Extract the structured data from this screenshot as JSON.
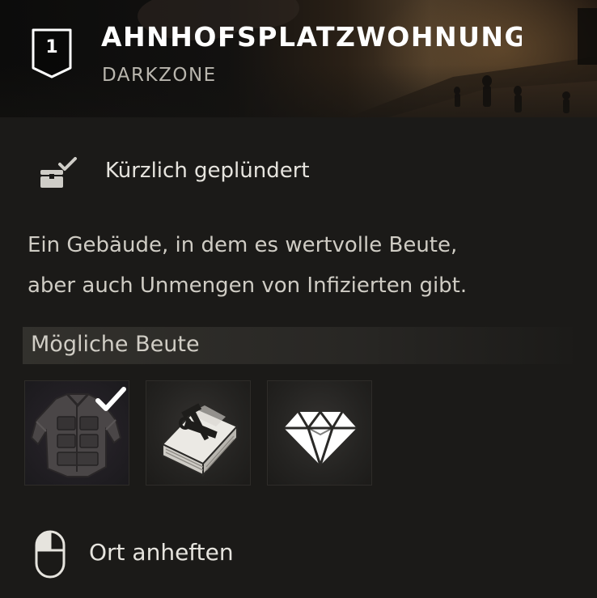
{
  "header": {
    "level": "1",
    "title": "AHNHOFSPLATZWOHNUNG",
    "subtitle": "DARKZONE"
  },
  "status": {
    "icon": "looted-chest-check-icon",
    "label": "Kürzlich geplündert"
  },
  "description": {
    "line1": "Ein Gebäude, in dem es wertvolle Beute,",
    "line2": "aber auch Unmengen von Infizierten gibt."
  },
  "loot": {
    "header": "Mögliche Beute",
    "items": [
      {
        "icon": "armor-vest-icon",
        "collected": true
      },
      {
        "icon": "crafting-manual-icon",
        "collected": false
      },
      {
        "icon": "gem-icon",
        "collected": false
      }
    ]
  },
  "pin": {
    "icon": "mouse-left-click-icon",
    "label": "Ort anheften"
  },
  "colors": {
    "background": "#1b1a18",
    "text": "#d8d6d0",
    "title": "#ffffff",
    "subtitle": "#b9b6ae"
  }
}
